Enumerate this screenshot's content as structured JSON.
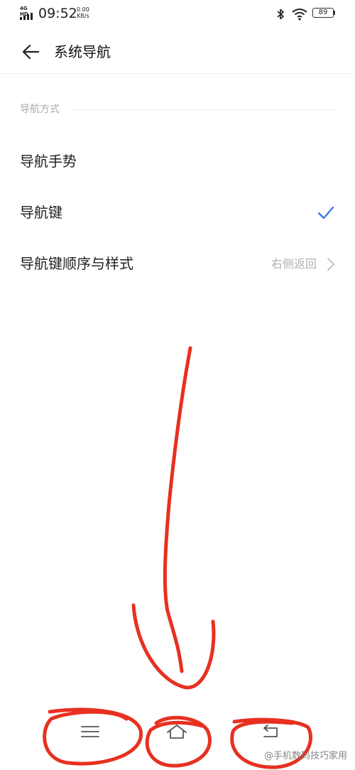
{
  "status_bar": {
    "network": "4G HD",
    "time": "09:52",
    "speed_value": "0.00",
    "speed_unit": "KB/s",
    "battery": "89",
    "icons": [
      "signal-icon",
      "bluetooth-icon",
      "wifi-icon",
      "battery-icon"
    ]
  },
  "header": {
    "back_icon": "arrow-left-icon",
    "title": "系统导航"
  },
  "section": {
    "label": "导航方式"
  },
  "options": [
    {
      "label": "导航手势",
      "selected": false
    },
    {
      "label": "导航键",
      "selected": true
    },
    {
      "label": "导航键顺序与样式",
      "value": "右侧返回"
    }
  ],
  "nav_bar": {
    "buttons": [
      "menu-icon",
      "home-icon",
      "back-icon"
    ]
  },
  "watermark": "@手机数码技巧家用",
  "colors": {
    "accent": "#3a78e0",
    "annotation": "#e83020",
    "secondary_text": "#aaaaaa"
  }
}
